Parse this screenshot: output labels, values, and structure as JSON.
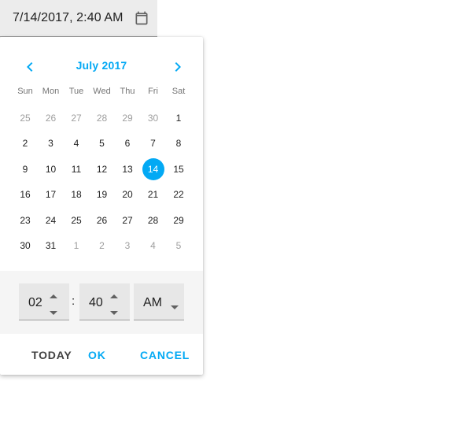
{
  "input": {
    "value": "7/14/2017, 2:40 AM",
    "icon": "calendar-icon"
  },
  "calendar": {
    "month_label": "July 2017",
    "weekdays": [
      "Sun",
      "Mon",
      "Tue",
      "Wed",
      "Thu",
      "Fri",
      "Sat"
    ],
    "weeks": [
      [
        "25",
        "26",
        "27",
        "28",
        "29",
        "30",
        "1"
      ],
      [
        "2",
        "3",
        "4",
        "5",
        "6",
        "7",
        "8"
      ],
      [
        "9",
        "10",
        "11",
        "12",
        "13",
        "14",
        "15"
      ],
      [
        "16",
        "17",
        "18",
        "19",
        "20",
        "21",
        "22"
      ],
      [
        "23",
        "24",
        "25",
        "26",
        "27",
        "28",
        "29"
      ],
      [
        "30",
        "31",
        "1",
        "2",
        "3",
        "4",
        "5"
      ]
    ],
    "selected_day": "14",
    "accent_color": "#03a9f4"
  },
  "time": {
    "hour": "02",
    "separator": ":",
    "minute": "40",
    "meridiem": "AM"
  },
  "actions": {
    "today": "TODAY",
    "ok": "OK",
    "cancel": "CANCEL"
  }
}
